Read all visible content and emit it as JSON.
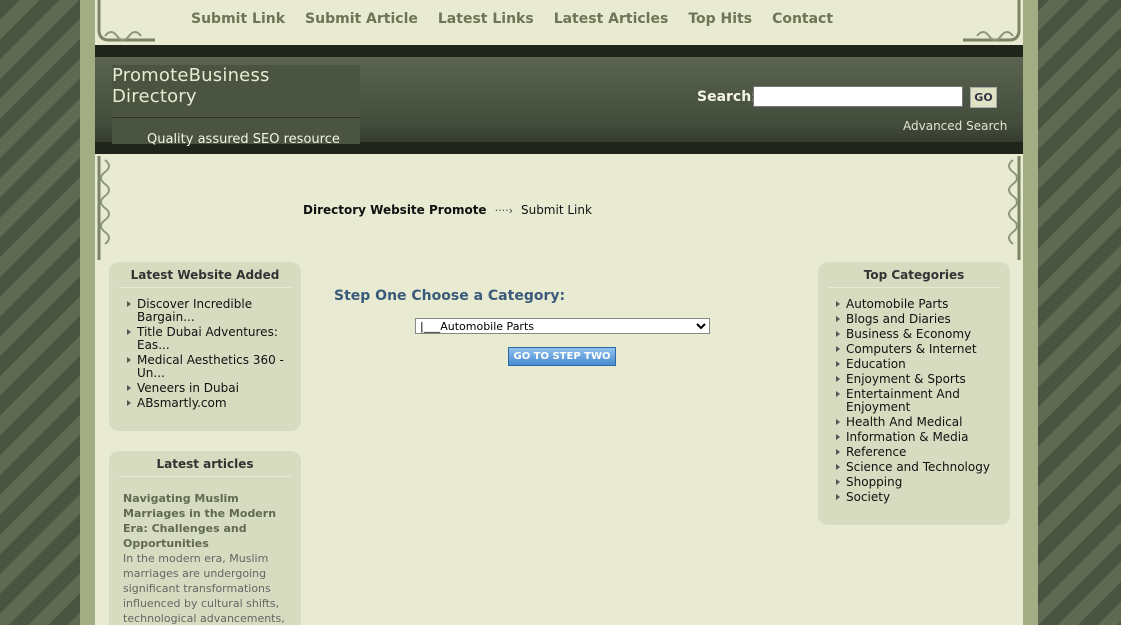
{
  "nav": {
    "items": [
      "Submit Link",
      "Submit Article",
      "Latest Links",
      "Latest Articles",
      "Top Hits",
      "Contact"
    ]
  },
  "header": {
    "site_name": "PromoteBusiness Directory",
    "tagline": "Quality assured SEO resource",
    "search_label": "Search:",
    "search_value": "",
    "go_label": "GO",
    "advanced_search": "Advanced Search"
  },
  "breadcrumb": {
    "home": "Directory Website Promote",
    "current": "Submit Link"
  },
  "latest_websites": {
    "title": "Latest Website Added",
    "items": [
      "Discover Incredible Bargain...",
      "Title Dubai Adventures: Eas...",
      "Medical Aesthetics 360 - Un...",
      "Veneers in Dubai",
      "ABsmartly.com"
    ]
  },
  "latest_articles": {
    "title": "Latest articles",
    "article_title": "Navigating Muslim Marriages in the Modern Era: Challenges and Opportunities",
    "article_text": "In the modern era, Muslim marriages are undergoing significant transformations influenced by cultural shifts, technological advancements,"
  },
  "main": {
    "step_title": "Step One Choose a Category:",
    "selected_category": "|___Automobile Parts",
    "button_label": "GO TO STEP TWO"
  },
  "top_categories": {
    "title": "Top Categories",
    "items": [
      "Automobile Parts",
      "Blogs and Diaries",
      "Business & Economy",
      "Computers & Internet",
      "Education",
      "Enjoyment & Sports",
      "Entertainment And Enjoyment",
      "Health And Medical",
      "Information & Media",
      "Reference",
      "Science and Technology",
      "Shopping",
      "Society"
    ]
  },
  "colors": {
    "page_bg": "#e8ebd2",
    "header_dark": "#434c3b",
    "box_bg": "#d7dbbf",
    "step_title": "#3a5a7a"
  }
}
